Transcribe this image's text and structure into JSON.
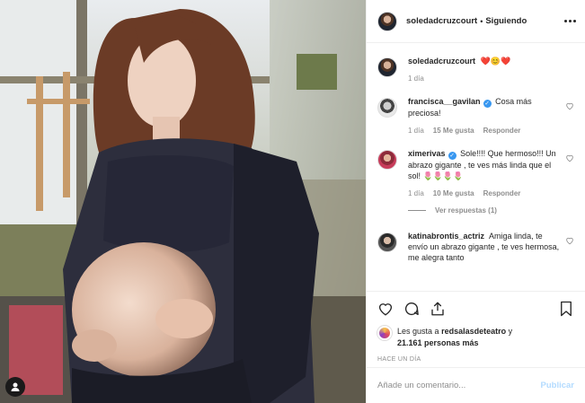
{
  "post": {
    "username": "soledadcruzcourt",
    "follow_status": "Siguiendo",
    "separator": "•"
  },
  "caption": {
    "username": "soledadcruzcourt",
    "text": "❤️😊❤️",
    "time": "1 día"
  },
  "comments": [
    {
      "username": "francisca__gavilan",
      "verified": true,
      "text": "Cosa más preciosa!",
      "time": "1 día",
      "likes": "15 Me gusta",
      "reply": "Responder"
    },
    {
      "username": "ximerivas",
      "verified": true,
      "text": "Sole!!!! Que hermoso!!! Un abrazo gigante , te ves más linda que el sol! 🌷🌷🌷🌷",
      "time": "1 día",
      "likes": "10 Me gusta",
      "reply": "Responder",
      "view_replies": "Ver respuestas (1)"
    },
    {
      "username": "katinabrontis_actriz",
      "verified": false,
      "text": "Amiga linda, te envío un abrazo gigante , te ves hermosa, me alegra tanto",
      "time": "",
      "likes": "",
      "reply": ""
    }
  ],
  "likes_summary": {
    "prefix": "Les gusta a",
    "user": "redsalasdeteatro",
    "middle": "y",
    "count": "21.161 personas más"
  },
  "timestamp": "HACE UN DÍA",
  "add_comment": {
    "placeholder": "Añade un comentario...",
    "publish_label": "Publicar"
  },
  "icons": {
    "more": "more-options-icon",
    "like": "heart-icon",
    "comment": "comment-icon",
    "share": "share-icon",
    "save": "bookmark-icon",
    "tag": "user-tag-icon"
  },
  "colors": {
    "verified": "#3897f0",
    "link_disabled": "#b3dbff",
    "muted": "#8e8e8e"
  }
}
